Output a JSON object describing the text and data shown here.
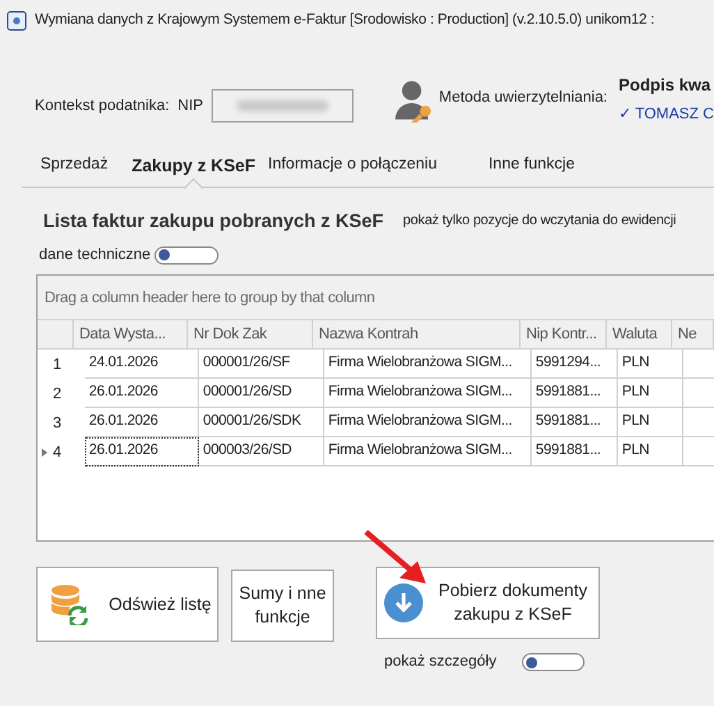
{
  "window": {
    "title": "Wymiana danych z Krajowym Systemem e-Faktur  [Srodowisko : Production] (v.2.10.5.0)  unikom12 :"
  },
  "context": {
    "label": "Kontekst podatnika:",
    "nip_label": "NIP",
    "nip_blurred": true,
    "auth_label": "Metoda uwierzytelniania:",
    "signature_title": "Podpis kwa",
    "signature_user": "✓ TOMASZ C"
  },
  "tabs": [
    {
      "label": "Sprzedaż",
      "selected": false
    },
    {
      "label": "Zakupy z KSeF",
      "selected": true
    },
    {
      "label": "Informacje o połączeniu",
      "selected": false
    },
    {
      "label": "Inne funkcje",
      "selected": false
    }
  ],
  "list": {
    "title": "Lista faktur zakupu pobranych z KSeF",
    "filter_label": "pokaż tylko pozycje do wczytania do ewidencji",
    "tech_toggle": {
      "label": "dane techniczne",
      "on": false
    }
  },
  "table": {
    "group_panel": "Drag a column header here to group by that column",
    "columns": [
      "Data Wysta...",
      "Nr Dok Zak",
      "Nazwa Kontrah",
      "Nip Kontr...",
      "Waluta",
      "Ne"
    ],
    "rows": [
      {
        "index": "1",
        "current": false,
        "cells": [
          "24.01.2026",
          "000001/26/SF",
          "Firma Wielobranżowa SIGM...",
          "5991294...",
          "PLN"
        ]
      },
      {
        "index": "2",
        "current": false,
        "cells": [
          "26.01.2026",
          "000001/26/SD",
          "Firma Wielobranżowa SIGM...",
          "5991881...",
          "PLN"
        ]
      },
      {
        "index": "3",
        "current": false,
        "cells": [
          "26.01.2026",
          "000001/26/SDK",
          "Firma Wielobranżowa SIGM...",
          "5991881...",
          "PLN"
        ]
      },
      {
        "index": "4",
        "current": true,
        "cells": [
          "26.01.2026",
          "000003/26/SD",
          "Firma Wielobranżowa SIGM...",
          "5991881...",
          "PLN"
        ]
      }
    ]
  },
  "buttons": [
    {
      "kind": "refresh",
      "label": "Odśwież listę"
    },
    {
      "kind": "text",
      "label": "Sumy i nne funkcje"
    },
    {
      "kind": "download",
      "label": "Pobierz dokumenty zakupu z KSeF"
    }
  ],
  "details_toggle": {
    "label": "pokaż szczegóły",
    "on": false
  }
}
